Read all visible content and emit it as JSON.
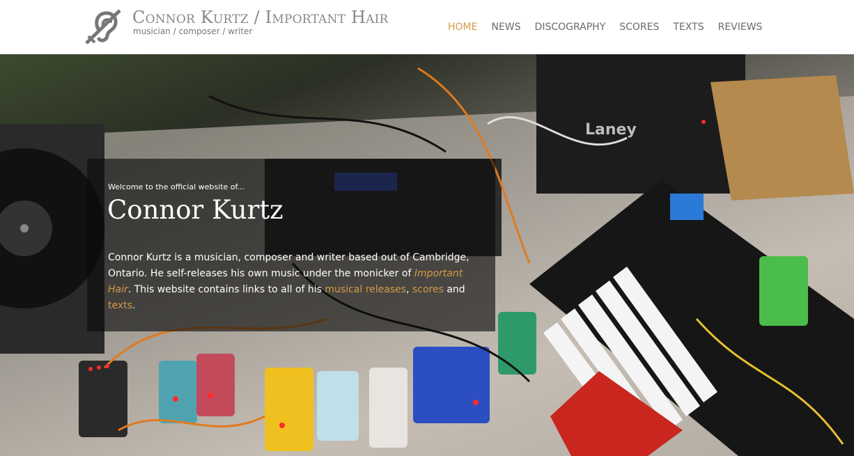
{
  "header": {
    "title": "Connor Kurtz / Important Hair",
    "tagline": "musician / composer / writer",
    "logo_icon": "hearing-assistance-icon"
  },
  "nav": {
    "items": [
      {
        "label": "HOME",
        "active": true
      },
      {
        "label": "NEWS",
        "active": false
      },
      {
        "label": "DISCOGRAPHY",
        "active": false
      },
      {
        "label": "SCORES",
        "active": false
      },
      {
        "label": "TEXTS",
        "active": false
      },
      {
        "label": "REVIEWS",
        "active": false
      }
    ]
  },
  "intro": {
    "welcome": "Welcome to the official website of...",
    "name": "Connor Kurtz",
    "body_1": "Connor Kurtz is a musician, composer and writer based out of Cambridge, Ontario. He self-releases his own music under the monicker of ",
    "link_important_hair": "Important Hair",
    "body_2": ". This website contains links to all of his ",
    "link_releases": "musical releases",
    "sep": ", ",
    "link_scores": "scores",
    "body_3": " and ",
    "link_texts": "texts",
    "body_4": "."
  },
  "colors": {
    "accent": "#d49a45",
    "nav_text": "#6a6a6a",
    "title_text": "#888888"
  }
}
